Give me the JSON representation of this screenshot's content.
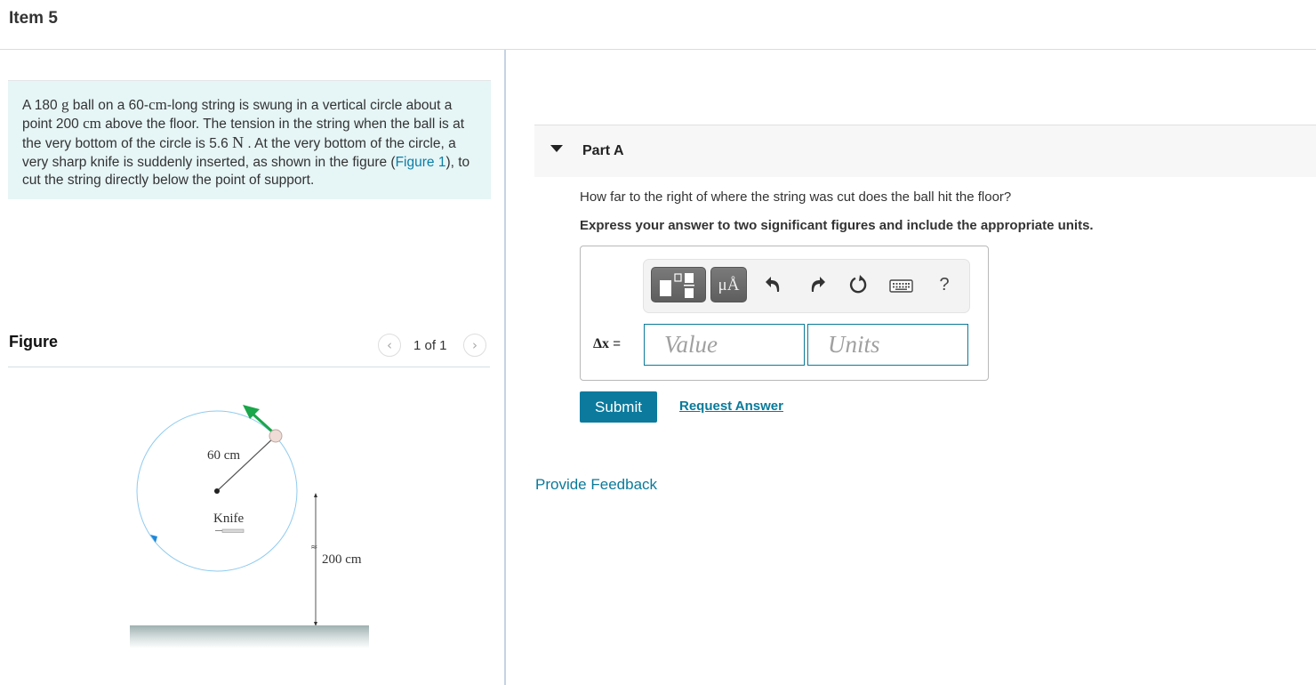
{
  "header": {
    "item_title": "Item 5"
  },
  "problem": {
    "segments": {
      "s1": "A 180 ",
      "m1": "g",
      "s2": " ball on a 60-",
      "m2": "cm",
      "s3": "-long string is swung in a vertical circle about a point 200 ",
      "m3": "cm",
      "s4": " above the floor. The tension in the string when the ball is at the very bottom of the circle is 5.6 ",
      "m4": "N",
      "s5": " . At the very bottom of the circle, a very sharp knife is suddenly inserted, as shown in the figure (",
      "link": "Figure 1",
      "s6": "), to cut the string directly below the point of support."
    }
  },
  "figure": {
    "label": "Figure",
    "counter": "1 of 1",
    "prev_icon": "chevron-left",
    "next_icon": "chevron-right",
    "labels": {
      "radius": "60 cm",
      "knife": "Knife",
      "height": "200 cm",
      "approx": "≈"
    },
    "colors": {
      "circle": "#8fcbef",
      "velocity_arrow": "#1aa64a",
      "ball": "#f0dcd6",
      "floor_top": "#a8b8b8"
    }
  },
  "part_a": {
    "title": "Part A",
    "question": "How far to the right of where the string was cut does the ball hit the floor?",
    "instruction": "Express your answer to two significant figures and include the appropriate units.",
    "variable_label": "Δx",
    "equals": " =",
    "value_placeholder": "Value",
    "units_placeholder": "Units",
    "value": "",
    "units": "",
    "toolbar": {
      "templates_icon": "templates-icon",
      "units_label": "μÅ",
      "undo_icon": "undo-icon",
      "redo_icon": "redo-icon",
      "reset_icon": "reset-icon",
      "keyboard_icon": "keyboard-icon",
      "help_label": "?"
    },
    "submit_label": "Submit",
    "request_answer_label": "Request Answer"
  },
  "feedback_label": "Provide Feedback",
  "colors": {
    "accent": "#0b7a9d",
    "problem_bg": "#e6f5f6",
    "part_header_bg": "#f7f7f7"
  }
}
